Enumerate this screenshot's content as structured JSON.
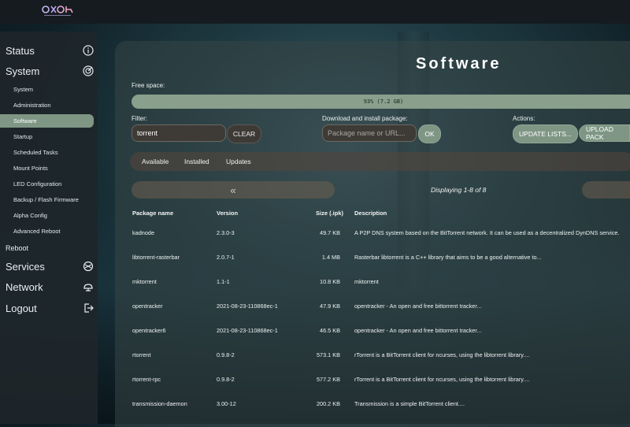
{
  "logo": {
    "alt": "Alpha OS logo"
  },
  "sidebar": {
    "items": [
      {
        "label": "Status",
        "icon": "info-icon"
      },
      {
        "label": "System",
        "icon": "radar-icon"
      },
      {
        "label": "Reboot",
        "icon": ""
      },
      {
        "label": "Services",
        "icon": "services-icon"
      },
      {
        "label": "Network",
        "icon": "network-icon"
      },
      {
        "label": "Logout",
        "icon": "logout-icon"
      }
    ],
    "system_subitems": [
      "System",
      "Administration",
      "Software",
      "Startup",
      "Scheduled Tasks",
      "Mount Points",
      "LED Configuration",
      "Backup / Flash Firmware",
      "Alpha Config",
      "Advanced Reboot"
    ],
    "active_subitem": "Software"
  },
  "page": {
    "title": "Software",
    "free_space_label": "Free space:",
    "free_space_value": "93% (7.2 GB)",
    "free_space_fraction": 0.93,
    "filter_label": "Filter:",
    "filter_value": "torrent",
    "clear_label": "CLEAR",
    "download_label": "Download and install package:",
    "download_placeholder": "Package name or URL...",
    "ok_label": "OK",
    "actions_label": "Actions:",
    "update_lists_label": "UPDATE LISTS...",
    "upload_package_label": "UPLOAD PACK",
    "tabs": [
      "Available",
      "Installed",
      "Updates"
    ],
    "pager_prev": "«",
    "display_info": "Displaying 1-8 of 8"
  },
  "table": {
    "headers": [
      "Package name",
      "Version",
      "Size (.ipk)",
      "Description"
    ],
    "rows": [
      {
        "name": "kadnode",
        "version": "2.3.0-3",
        "size": "49.7 KB",
        "description": "A P2P DNS system based on the BitTorrent network. It can be used as a decentralized DynDNS service."
      },
      {
        "name": "libtorrent-rasterbar",
        "version": "2.0.7-1",
        "size": "1.4 MB",
        "description": "Rasterbar libtorrent is a C++ library that aims to be a good alternative to..."
      },
      {
        "name": "mktorrent",
        "version": "1.1-1",
        "size": "10.8 KB",
        "description": "mktorrent"
      },
      {
        "name": "opentracker",
        "version": "2021-08-23-110868ec-1",
        "size": "47.9 KB",
        "description": "opentracker - An open and free bittorrent tracker..."
      },
      {
        "name": "opentracker6",
        "version": "2021-08-23-110868ec-1",
        "size": "46.5 KB",
        "description": "opentracker - An open and free bittorrent tracker..."
      },
      {
        "name": "rtorrent",
        "version": "0.9.8-2",
        "size": "573.1 KB",
        "description": "rTorrent is a BitTorrent client for ncurses, using the libtorrent library...."
      },
      {
        "name": "rtorrent-rpc",
        "version": "0.9.8-2",
        "size": "577.2 KB",
        "description": "rTorrent is a BitTorrent client for ncurses, using the libtorrent library...."
      },
      {
        "name": "transmission-daemon",
        "version": "3.00-12",
        "size": "200.2 KB",
        "description": "Transmission is a simple BitTorrent client...."
      }
    ]
  }
}
